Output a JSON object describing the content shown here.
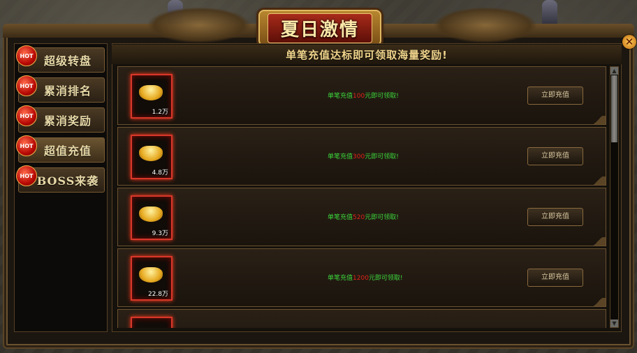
{
  "window": {
    "title": "夏日激情",
    "close_symbol": "✕"
  },
  "sidebar": {
    "hot_badge": "HOT",
    "items": [
      {
        "label": "超级转盘"
      },
      {
        "label": "累消排名"
      },
      {
        "label": "累消奖励"
      },
      {
        "label": "超值充值",
        "active": true
      },
      {
        "label": "BOSS来袭"
      }
    ]
  },
  "main": {
    "banner": "单笔充值达标即可领取海量奖励!",
    "button_label": "立即充值",
    "rewards": [
      {
        "prefix": "单笔充值",
        "amount": "100",
        "suffix": "元即可领取!",
        "qty": "1.2万"
      },
      {
        "prefix": "单笔充值",
        "amount": "300",
        "suffix": "元即可领取!",
        "qty": "4.8万"
      },
      {
        "prefix": "单笔充值",
        "amount": "520",
        "suffix": "元即可领取!",
        "qty": "9.3万"
      },
      {
        "prefix": "单笔充值",
        "amount": "1200",
        "suffix": "元即可领取!",
        "qty": "22.8万"
      }
    ]
  },
  "colors": {
    "accent_gold": "#f1d58c",
    "green_text": "#3cd83c",
    "red_amount": "#e0241a"
  },
  "icons": {
    "item": "gold-ingot-icon",
    "close": "close-icon",
    "badge": "hot-badge-icon"
  }
}
